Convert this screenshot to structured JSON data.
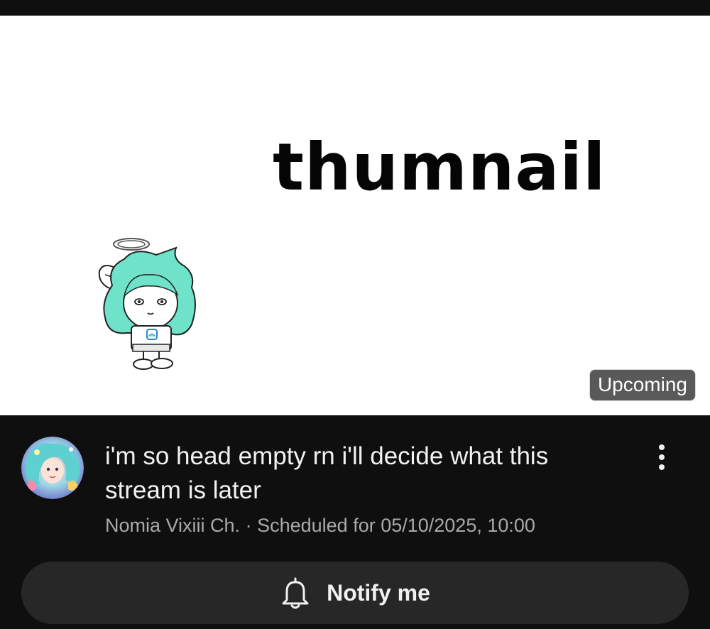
{
  "thumbnail": {
    "text": "thumnail",
    "badge": "Upcoming",
    "mascot_icon": "angel-mascot-icon"
  },
  "video": {
    "title": "i'm so head empty rn i'll decide what this stream is later",
    "channel": "Nomia Vixiii Ch.",
    "separator": "·",
    "schedule": "Scheduled for 05/10/2025, 10:00"
  },
  "actions": {
    "notify_label": "Notify me",
    "notify_icon": "bell-icon",
    "more_icon": "more-vert-icon"
  },
  "colors": {
    "background": "#0f0f0f",
    "button": "#272727",
    "text_primary": "#f1f1f1",
    "text_secondary": "#aaaaaa",
    "mascot_hair": "#6fe3c9"
  }
}
